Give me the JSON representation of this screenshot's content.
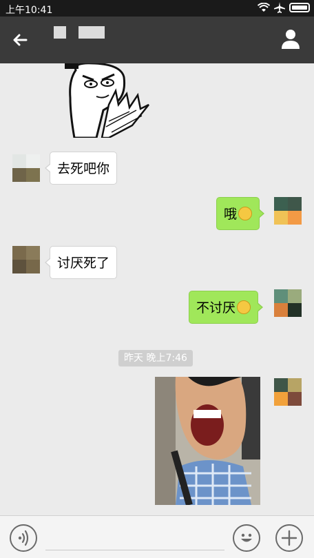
{
  "status_bar": {
    "time": "上午10:41"
  },
  "header": {
    "back_icon": "back-arrow-icon",
    "profile_icon": "profile-icon"
  },
  "messages": [
    {
      "type": "image",
      "direction": "in",
      "image": "rage-comic-meme"
    },
    {
      "type": "text",
      "direction": "in",
      "text": "去死吧你"
    },
    {
      "type": "text",
      "direction": "out",
      "text": "哦",
      "emoji": "frowning-face-icon"
    },
    {
      "type": "text",
      "direction": "in",
      "text": "讨厌死了"
    },
    {
      "type": "text",
      "direction": "out",
      "text": "不讨厌",
      "emoji": "heart-eyes-face-icon"
    },
    {
      "type": "timestamp",
      "text": "昨天 晚上7:46"
    },
    {
      "type": "image",
      "direction": "out",
      "image": "laughing-man-photo"
    }
  ],
  "input_bar": {
    "voice_icon": "voice-icon",
    "emoji_icon": "smiley-icon",
    "plus_icon": "plus-icon"
  },
  "colors": {
    "header_bg": "#3a3a3a",
    "chat_bg": "#ebebeb",
    "outgoing_bubble": "#a0e75a",
    "incoming_bubble": "#ffffff"
  }
}
